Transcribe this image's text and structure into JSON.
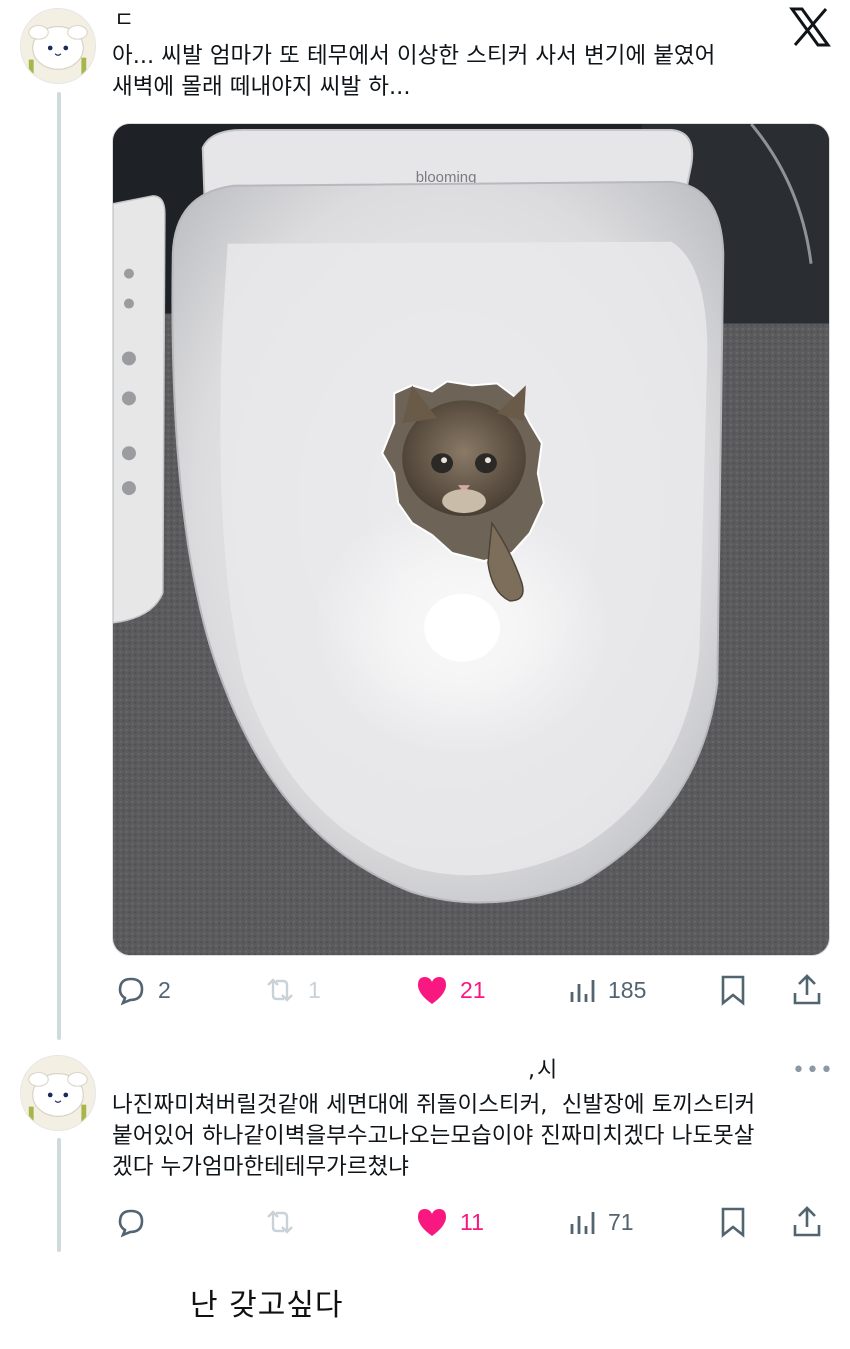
{
  "tweet1": {
    "handle_fragment": "ㄷ",
    "text": "아... 씨발 엄마가 또 테무에서 이상한 스티커 사서 변기에 붙였어\n새벽에 몰래 떼내야지 씨발 하...",
    "image_brand": "blooming",
    "replies": "2",
    "retweets": "1",
    "likes": "21",
    "views": "185"
  },
  "tweet2": {
    "handle_fragment": ",시",
    "text": "나진짜미쳐버릴것같애 세면대에 쥐돌이스티커,  신발장에 토끼스티커\n붙어있어 하나같이벽을부수고나오는모습이야 진짜미치겠다 나도못살\n겠다 누가엄마한테테무가르쳤냐",
    "replies": "",
    "retweets": "",
    "likes": "11",
    "views": "71"
  },
  "comment": "난 갖고싶다",
  "colors": {
    "text": "#0f1419",
    "muted": "#536471",
    "like": "#f91880",
    "thread_line": "#cfd9de"
  }
}
